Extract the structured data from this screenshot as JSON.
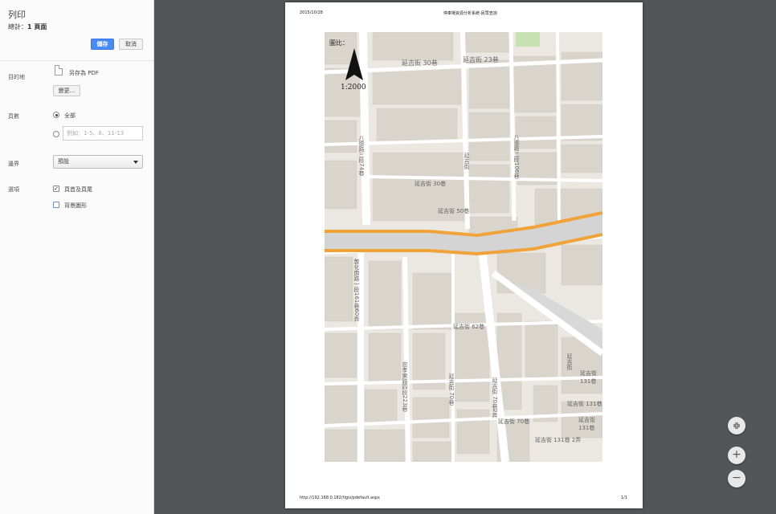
{
  "panel": {
    "title": "列印",
    "total_label": "總計：",
    "total_value": "1 頁面",
    "save_label": "儲存",
    "cancel_label": "取消",
    "destination_label": "目的地",
    "destination_value": "另存為 PDF",
    "change_label": "變更...",
    "pages_label": "頁數",
    "pages_all_label": "全部",
    "pages_range_placeholder": "例如：1-5、8、11-13",
    "margins_label": "邊界",
    "margins_value": "預設",
    "options_label": "選項",
    "option_header_footer": "頁首及頁尾",
    "option_background": "背景圖形"
  },
  "page": {
    "date": "2015/10/28",
    "title": "停車場資源分析系統-民眾查詢",
    "url": "http://192.168.0.182/tlgis/pdefault.aspx",
    "page_number": "1/1"
  },
  "map": {
    "legend_label": "圖比：",
    "scale": "1:2000",
    "streets": {
      "s1": "延吉街 30巷",
      "s2": "延吉街 23巷",
      "s3": "八德路三段74巷",
      "s4": "八德路三段106巷",
      "s5": "延吉街",
      "s6": "延吉街 30巷",
      "s7": "延吉街 50巷",
      "s8": "敦化南路一段161巷60弄",
      "s9": "延吉街 62巷",
      "s10": "忠孝東路四段223巷",
      "s11": "延吉街 70巷",
      "s12": "延吉街 70巷2弄",
      "s13": "延吉街",
      "s14": "延吉街 131巷",
      "s15": "延吉街 131巷 2弄",
      "s16": "延吉街 70巷",
      "s17": "延吉街 131巷",
      "s18": "延吉街 131巷"
    }
  },
  "zoom": {
    "fit_icon": "fit-to-page-icon",
    "in_label": "+",
    "out_label": "−"
  },
  "colors": {
    "accent": "#4a8af4",
    "preview_bg": "#525659",
    "road_orange": "#f0a33a",
    "map_bg": "#ebe8e2",
    "building": "#d9d5cc",
    "park": "#c6e2b3"
  }
}
